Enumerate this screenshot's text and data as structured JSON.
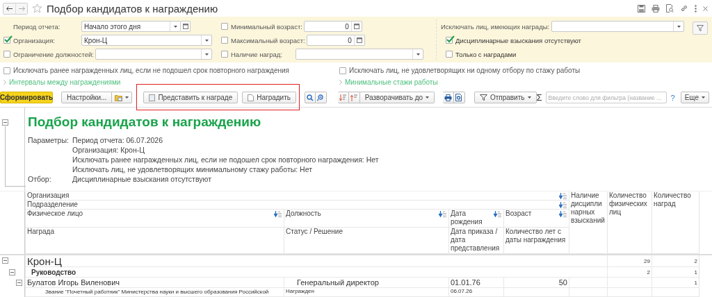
{
  "window": {
    "title": "Подбор кандидатов к награждению"
  },
  "settings": {
    "column_1": [
      {
        "kind": "period",
        "label": "Период отчета:",
        "value": "Начало этого дня"
      },
      {
        "kind": "select",
        "label": "Организация:",
        "value": "Крон-Ц",
        "checked": true
      },
      {
        "kind": "select",
        "label": "Ограничение должностей:",
        "checked": false
      }
    ],
    "column_2": [
      {
        "kind": "number",
        "label": "Минимальный возраст:",
        "value": "0",
        "checked": false
      },
      {
        "kind": "number",
        "label": "Максимальный возраст:",
        "value": "0",
        "checked": false
      },
      {
        "kind": "select",
        "label": "Наличие наград:",
        "checked": false
      }
    ],
    "column_3": {
      "field": {
        "label": "Исключать лиц, имеющих награды:"
      },
      "options": [
        {
          "label": "Дисциплинарные взыскания отсутствуют",
          "checked": true
        },
        {
          "label": "Только с наградами",
          "checked": false
        }
      ]
    }
  },
  "options": [
    {
      "label": "Исключать ранее награжденных лиц, если не подошел срок повторного награждения",
      "checked": false
    },
    {
      "label": "Исключать лиц, не удовлетворящих ни одному отбору по стажу работы",
      "checked": false
    }
  ],
  "links": [
    "Интервалы между награждениями",
    "Минимальные стажи работы"
  ],
  "toolbar": {
    "generate": "Сформировать",
    "settings": "Настройки...",
    "present": "Представить к награде",
    "award": "Наградить",
    "expand": "Разворачивать до",
    "send": "Отправить",
    "search": {
      "placeholder": "Введите слово для фильтра (название ..."
    },
    "sum": "Σ",
    "help": "?",
    "more": "Еще"
  },
  "report": {
    "title": "Подбор кандидатов к награждению",
    "expanded": true,
    "parameters_label": "Параметры:",
    "parameters": [
      "Период отчета: 06.07.2026",
      "Организация: Крон-Ц",
      "Исключать ранее награжденных лиц, если не подошел срок повторного награждения: Нет",
      "Исключать лиц, не удовлетворящих минимальному стажу работы: Нет"
    ],
    "filter_label": "Отбор:",
    "filters": [
      "Дисциплинарные взыскания отсутствуют"
    ],
    "header": [
      {
        "text": "Организация",
        "sort_icon": true
      },
      {
        "text": "Подразделение",
        "sort_icon": true
      },
      {
        "text": "Физическое лицо",
        "sort_icon": true
      },
      {
        "text": "Должность",
        "sort_icon": true
      },
      {
        "text": "Дата рождения",
        "sort_icon": true
      },
      {
        "text": "Возраст",
        "sort_icon": true
      },
      {
        "text": "Награда",
        "sort_icon": false
      },
      {
        "text": "Статус / Решение",
        "sort_icon": false
      },
      {
        "text": "Дата приказа / дата представления",
        "sort_icon": false
      },
      {
        "text": "Количество лет с даты награждения",
        "sort_icon": false
      },
      {
        "text": "Наличие дисциплинарных взысканий",
        "sort_icon": false
      },
      {
        "text": "Количество физических лиц",
        "sort_icon": false
      },
      {
        "text": "Количество наград",
        "sort_icon": false
      }
    ],
    "rows": [
      {
        "kind": "organization",
        "expanded": true,
        "name": "Крон-Ц",
        "persons": "29",
        "awards": "2",
        "children": [
          {
            "kind": "department",
            "expanded": true,
            "name": "Руководство",
            "persons": "2",
            "awards": "1",
            "children": [
              {
                "kind": "person",
                "expanded": true,
                "name": "Булатов Игорь Виленович",
                "position": "Генеральный директор",
                "birth_date": "01.01.76",
                "age": "50",
                "awards": "1",
                "children": [
                  {
                    "kind": "award",
                    "name": "Звание \"Почетный работник\" Министерства науки и высшего образования Российской",
                    "status": "Награжден",
                    "date": "06.07.26"
                  }
                ]
              }
            ]
          }
        ]
      }
    ]
  }
}
